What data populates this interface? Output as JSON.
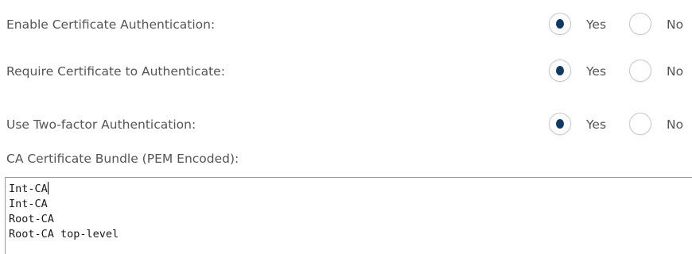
{
  "settings": [
    {
      "label": "Enable Certificate Authentication:",
      "selected": "Yes",
      "options": [
        "Yes",
        "No"
      ]
    },
    {
      "label": "Require Certificate to Authenticate:",
      "selected": "Yes",
      "options": [
        "Yes",
        "No"
      ]
    },
    {
      "label": "Use Two-factor Authentication:",
      "selected": "Yes",
      "options": [
        "Yes",
        "No"
      ]
    }
  ],
  "bundle": {
    "label": "CA Certificate Bundle (PEM Encoded):",
    "lines": [
      "Int-CA",
      "Int-CA",
      "Root-CA",
      "Root-CA top-level"
    ]
  },
  "colors": {
    "radio_selected": "#0f3a66",
    "text": "#555555",
    "border": "#9a9a9a"
  }
}
